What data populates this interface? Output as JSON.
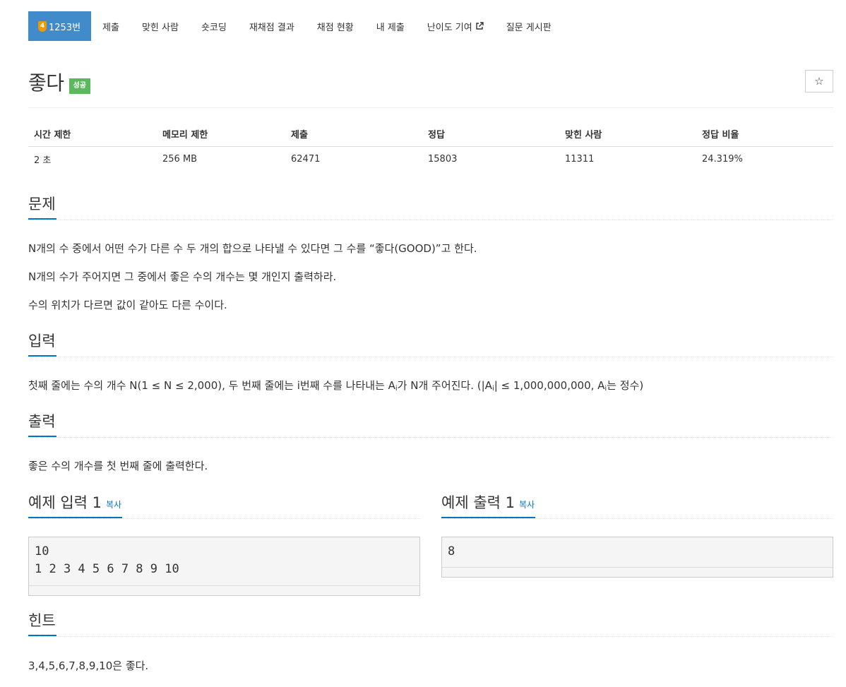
{
  "nav": {
    "problem_number": "1253번",
    "tier_badge": "4",
    "tier_color": "#ec9a00",
    "items": [
      "제출",
      "맞힌 사람",
      "숏코딩",
      "재채점 결과",
      "채점 현황",
      "내 제출",
      "난이도 기여",
      "질문 게시판"
    ],
    "active_color": "#428bca"
  },
  "problem": {
    "title": "좋다",
    "status_badge": "성공",
    "star_icon": "☆"
  },
  "stats": {
    "headers": [
      "시간 제한",
      "메모리 제한",
      "제출",
      "정답",
      "맞힌 사람",
      "정답 비율"
    ],
    "values": [
      "2 초",
      "256 MB",
      "62471",
      "15803",
      "11311",
      "24.319%"
    ]
  },
  "sections": {
    "description_title": "문제",
    "description": [
      "N개의 수 중에서 어떤 수가 다른 수 두 개의 합으로 나타낼 수 있다면 그 수를 “좋다(GOOD)”고 한다.",
      "N개의 수가 주어지면 그 중에서 좋은 수의 개수는 몇 개인지 출력하라.",
      "수의 위치가 다르면 값이 같아도 다른 수이다."
    ],
    "input_title": "입력",
    "input_parts": {
      "p1": "첫째 줄에는 수의 개수 N(1 ≤ N ≤ 2,000), 두 번째 줄에는 i번째 수를 나타내는 A",
      "s1": "i",
      "p2": "가 N개 주어진다. (|A",
      "s2": "i",
      "p3": "| ≤ 1,000,000,000, A",
      "s3": "i",
      "p4": "는 정수)"
    },
    "output_title": "출력",
    "output": "좋은 수의 개수를 첫 번째 줄에 출력한다.",
    "sample_input_title": "예제 입력 1",
    "sample_output_title": "예제 출력 1",
    "copy_label": "복사",
    "sample_input": "10\n1 2 3 4 5 6 7 8 9 10",
    "sample_output": "8",
    "hint_title": "힌트",
    "hint": "3,4,5,6,7,8,9,10은 좋다."
  },
  "colors": {
    "accent": "#0076c0",
    "success": "#5cb85c"
  }
}
